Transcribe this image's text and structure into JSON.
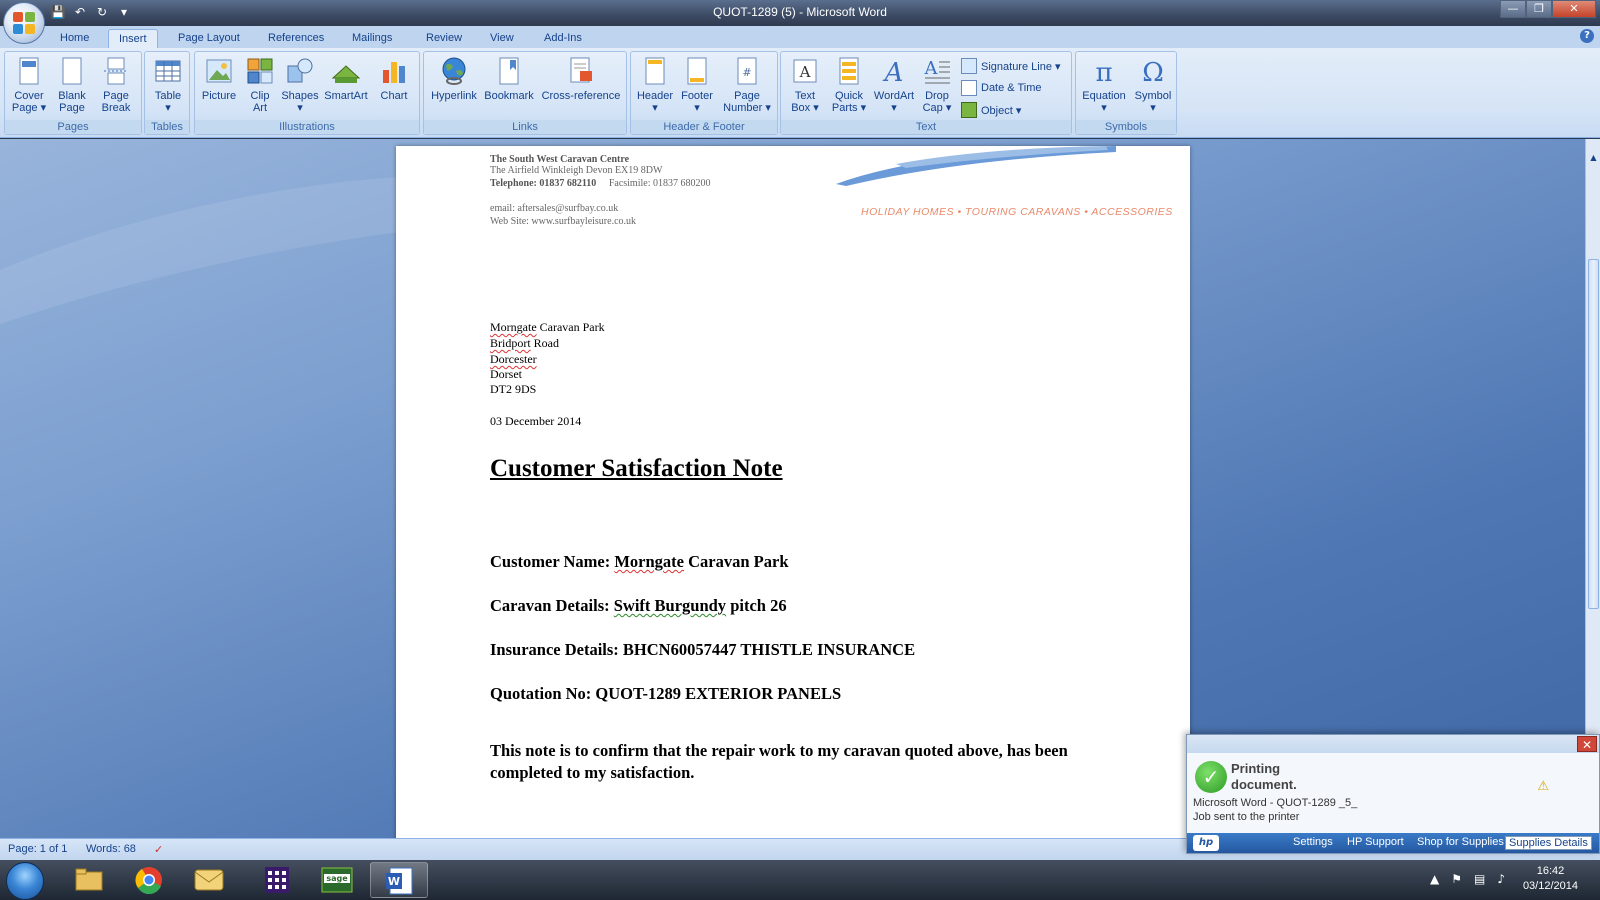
{
  "window": {
    "title": "QUOT-1289 (5) - Microsoft Word",
    "controls": {
      "minimize": "—",
      "maximize": "❐",
      "close": "✕"
    }
  },
  "qat": {
    "save": "💾",
    "undo": "↶",
    "redo": "↻",
    "customize": "▾"
  },
  "tabs": [
    "Home",
    "Insert",
    "Page Layout",
    "References",
    "Mailings",
    "Review",
    "View",
    "Add-Ins"
  ],
  "active_tab": "Insert",
  "help": "?",
  "ribbon": {
    "groups": {
      "pages": "Pages",
      "tables": "Tables",
      "illustrations": "Illustrations",
      "links": "Links",
      "header_footer": "Header & Footer",
      "text": "Text",
      "symbols": "Symbols"
    },
    "buttons": {
      "cover_page": [
        "Cover",
        "Page ▾"
      ],
      "blank_page": [
        "Blank",
        "Page"
      ],
      "page_break": [
        "Page",
        "Break"
      ],
      "table": [
        "Table",
        "▾"
      ],
      "picture": [
        "Picture",
        ""
      ],
      "clip_art": [
        "Clip",
        "Art"
      ],
      "shapes": [
        "Shapes",
        "▾"
      ],
      "smartart": [
        "SmartArt",
        ""
      ],
      "chart": [
        "Chart",
        ""
      ],
      "hyperlink": [
        "Hyperlink",
        ""
      ],
      "bookmark": [
        "Bookmark",
        ""
      ],
      "cross_reference": [
        "Cross-reference",
        ""
      ],
      "header": [
        "Header",
        "▾"
      ],
      "footer": [
        "Footer",
        "▾"
      ],
      "page_number": [
        "Page",
        "Number ▾"
      ],
      "text_box": [
        "Text",
        "Box ▾"
      ],
      "quick_parts": [
        "Quick",
        "Parts ▾"
      ],
      "wordart": [
        "WordArt",
        "▾"
      ],
      "drop_cap": [
        "Drop",
        "Cap ▾"
      ],
      "equation": [
        "Equation",
        "▾"
      ],
      "symbol": [
        "Symbol",
        "▾"
      ]
    },
    "small_buttons": {
      "signature_line": "Signature Line ▾",
      "date_time": "Date & Time",
      "object": "Object ▾"
    }
  },
  "document": {
    "letterhead": {
      "company": "The South West Caravan Centre",
      "address": "The Airfield Winkleigh Devon EX19 8DW",
      "telephone": "Telephone: 01837 682110",
      "facsimile": "Facsimile: 01837 680200",
      "email": "email: aftersales@surfbay.co.uk",
      "website": "Web Site: www.surfbayleisure.co.uk",
      "tagline": "HOLIDAY HOMES • TOURING CARAVANS • ACCESSORIES"
    },
    "recipient": {
      "line1_a": "Morngate",
      "line1_b": " Caravan Park",
      "line2_a": "Bridport",
      "line2_b": " Road",
      "line3": "Dorcester",
      "line4": "Dorset",
      "line5": "DT2 9DS"
    },
    "date": "03 December 2014",
    "title": "Customer Satisfaction Note",
    "customer_name_label": "Customer Name: ",
    "customer_name_a": "Morngate",
    "customer_name_b": " Caravan Park",
    "caravan_label": "Caravan Details: ",
    "caravan_a": "Swift  Burgundy",
    "caravan_b": " pitch 26",
    "insurance": "Insurance Details:   BHCN60057447 THISTLE  INSURANCE",
    "quotation": "Quotation No: QUOT-1289 EXTERIOR PANELS",
    "confirm": "This note is to confirm that the repair work to my caravan quoted above, has been completed to my satisfaction."
  },
  "status": {
    "page": "Page: 1 of 1",
    "words": "Words: 68"
  },
  "popup": {
    "title": "Printing document.",
    "line1": "Microsoft Word - QUOT-1289 _5_",
    "line2": "Job sent to the printer",
    "links": [
      "Settings",
      "HP Support",
      "Shop for Supplies",
      "Supplies Details"
    ],
    "hp": "hp"
  },
  "clock": {
    "time": "16:42",
    "date": "03/12/2014"
  },
  "colors": {
    "ribbon": "#d5e4f6",
    "accent": "#15428b",
    "doc_bg": "#4f77b3",
    "logo_blue": "#6a9ad8",
    "tagline": "#e88a6a"
  }
}
